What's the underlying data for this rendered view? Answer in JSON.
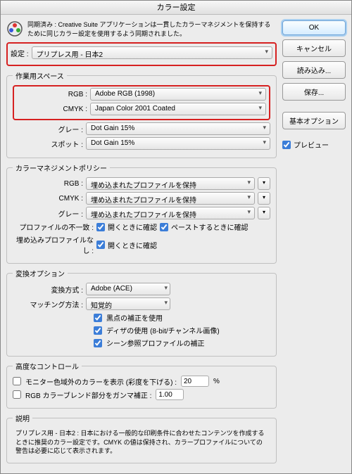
{
  "title": "カラー設定",
  "sync_text": "同期済み : Creative Suite アプリケーションは一貫したカラーマネジメントを保持するために同じカラー設定を使用するよう同期されました。",
  "setting_label": "設定 :",
  "setting_value": "プリプレス用 - 日本2",
  "buttons": {
    "ok": "OK",
    "cancel": "キャンセル",
    "load": "読み込み...",
    "save": "保存...",
    "basic": "基本オプション"
  },
  "preview_label": "プレビュー",
  "workspace": {
    "legend": "作業用スペース",
    "rgb_label": "RGB :",
    "rgb_value": "Adobe RGB (1998)",
    "cmyk_label": "CMYK :",
    "cmyk_value": "Japan Color 2001 Coated",
    "gray_label": "グレー :",
    "gray_value": "Dot Gain 15%",
    "spot_label": "スポット :",
    "spot_value": "Dot Gain 15%"
  },
  "policy": {
    "legend": "カラーマネジメントポリシー",
    "rgb_label": "RGB :",
    "rgb_value": "埋め込まれたプロファイルを保持",
    "cmyk_label": "CMYK :",
    "cmyk_value": "埋め込まれたプロファイルを保持",
    "gray_label": "グレー :",
    "gray_value": "埋め込まれたプロファイルを保持",
    "mismatch_label": "プロファイルの不一致 :",
    "mismatch_open": "開くときに確認",
    "mismatch_paste": "ペーストするときに確認",
    "missing_label": "埋め込みプロファイルなし :",
    "missing_open": "開くときに確認"
  },
  "convert": {
    "legend": "変換オプション",
    "engine_label": "変換方式 :",
    "engine_value": "Adobe (ACE)",
    "intent_label": "マッチング方法 :",
    "intent_value": "知覚的",
    "bpc": "黒点の補正を使用",
    "dither": "ディザの使用 (8-bit/チャンネル画像)",
    "scene": "シーン参照プロファイルの補正"
  },
  "advanced": {
    "legend": "高度なコントロール",
    "monitor": "モニター色域外のカラーを表示 (彩度を下げる) :",
    "monitor_val": "20",
    "percent": "%",
    "blend": "RGB カラーブレンド部分をガンマ補正 :",
    "blend_val": "1.00"
  },
  "description": {
    "legend": "説明",
    "text": "プリプレス用 - 日本2 : 日本における一般的な印刷条件に合わせたコンテンツを作成するときに推奨のカラー設定です。CMYK の値は保持され、カラープロファイルについての警告は必要に応じて表示されます。"
  }
}
